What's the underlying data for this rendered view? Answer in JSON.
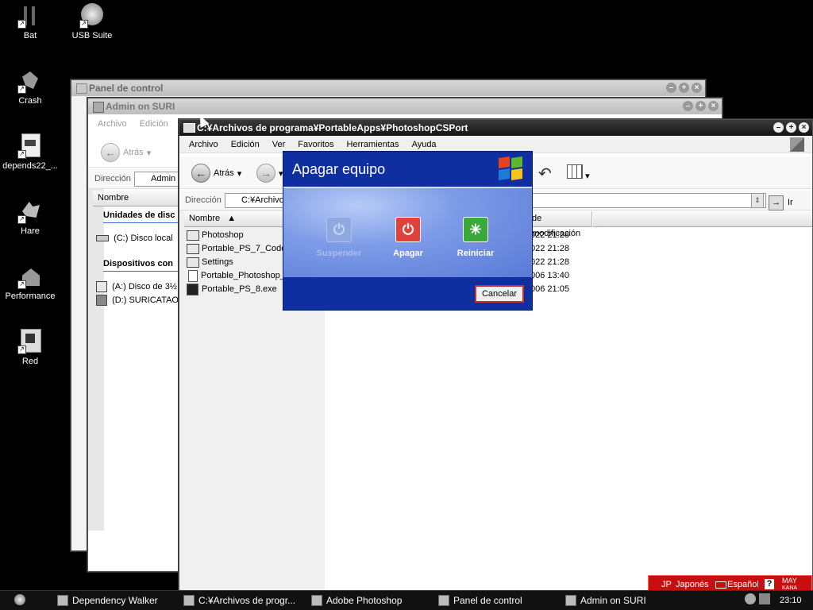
{
  "desktop": {
    "icons": [
      {
        "label": "Bat"
      },
      {
        "label": "USB Suite"
      },
      {
        "label": "Crash"
      },
      {
        "label": "depends22_..."
      },
      {
        "label": "Hare"
      },
      {
        "label": "Performance"
      },
      {
        "label": "Red"
      }
    ]
  },
  "window_control_panel": {
    "title": "Panel de control"
  },
  "window_admin": {
    "title": "Admin on SURI",
    "menu": [
      "Archivo",
      "Edición"
    ],
    "back_label": "Atrás",
    "address_label": "Dirección",
    "address_value": "Admin o",
    "col_name": "Nombre",
    "section_drives": "Unidades de disc",
    "drive_c": "(C:) Disco local",
    "section_devices": "Dispositivos con",
    "drive_a": "(A:) Disco de 3½",
    "drive_d": "(D:) SURICATAO."
  },
  "window_explorer": {
    "title": "C:¥Archivos de programa¥PortableApps¥PhotoshopCSPort",
    "menu": [
      "Archivo",
      "Edición",
      "Ver",
      "Favoritos",
      "Herramientas",
      "Ayuda"
    ],
    "back_label": "Atrás",
    "address_label": "Dirección",
    "address_value": "C:¥Archivo",
    "go_label": "Ir",
    "col_name": "Nombre",
    "col_modified": "de modificación",
    "files": [
      {
        "name": "Photoshop",
        "date": "022 21:28",
        "kind": "folder"
      },
      {
        "name": "Portable_PS_7_Code",
        "date": "022 21:28",
        "kind": "folder"
      },
      {
        "name": "Settings",
        "date": "022 21:28",
        "kind": "folder"
      },
      {
        "name": "Portable_Photoshop_",
        "date": "006 13:40",
        "kind": "doc"
      },
      {
        "name": "Portable_PS_8.exe",
        "date": "006 21:05",
        "kind": "exe"
      }
    ]
  },
  "dialog": {
    "title": "Apagar equipo",
    "suspend_label": "Suspender",
    "shutdown_label": "Apagar",
    "restart_label": "Reiniciar",
    "cancel_label": "Cancelar"
  },
  "taskbar": {
    "tasks": [
      {
        "label": "Dependency Walker"
      },
      {
        "label": "C:¥Archivos de progr..."
      },
      {
        "label": "Adobe Photoshop"
      },
      {
        "label": "Panel de control"
      },
      {
        "label": "Admin on SURI"
      }
    ],
    "clock": "23:10"
  },
  "langbar": {
    "jp_code": "JP",
    "jp_label": "Japonés",
    "es_label": "Español",
    "help_glyph": "?",
    "caps": "MAY",
    "kana": "KANA"
  },
  "colors": {
    "dialog_blue": "#0f2fa0",
    "langbar_red": "#c61010",
    "shutdown_red": "#e0413a",
    "restart_green": "#3aa83a"
  }
}
